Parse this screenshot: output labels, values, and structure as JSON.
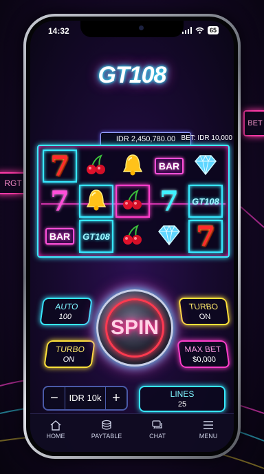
{
  "status": {
    "time": "14:32",
    "battery": "65"
  },
  "logo": {
    "text": "GT108"
  },
  "balance": {
    "text": "IDR 2,450,780.00"
  },
  "bet": {
    "text": "BET: IDR 10,000"
  },
  "reels": [
    [
      "seven",
      "cherry",
      "bell",
      "bar",
      "diamond"
    ],
    [
      "seven-pink",
      "bell",
      "cherry",
      "seven-cyan",
      "gt108"
    ],
    [
      "bar",
      "gt108",
      "cherry",
      "diamond",
      "seven"
    ]
  ],
  "symbol_labels": {
    "bar": "BAR",
    "gt108": "GT108",
    "seven": "7"
  },
  "auto": {
    "label": "AUTO",
    "value": "100"
  },
  "turbo_right": {
    "label": "TURBO",
    "value": "ON"
  },
  "turbo_left": {
    "label": "TURBO",
    "value": "ON"
  },
  "max_bet": {
    "label": "MAX BET",
    "value": "$0,000"
  },
  "spin": {
    "label": "SPIN"
  },
  "bet_stepper": {
    "minus": "−",
    "value": "IDR 10k",
    "plus": "+"
  },
  "lines": {
    "label": "LINES",
    "value": "25"
  },
  "nav": [
    {
      "icon": "home-icon",
      "label": "HOME"
    },
    {
      "icon": "paytable-icon",
      "label": "PAYTABLE"
    },
    {
      "icon": "chat-icon",
      "label": "CHAT"
    },
    {
      "icon": "menu-icon",
      "label": "MENU"
    }
  ],
  "colors": {
    "cyan": "#37e8ff",
    "pink": "#ff3ecb",
    "yellow": "#ffe23a",
    "red": "#ff3a4f"
  }
}
